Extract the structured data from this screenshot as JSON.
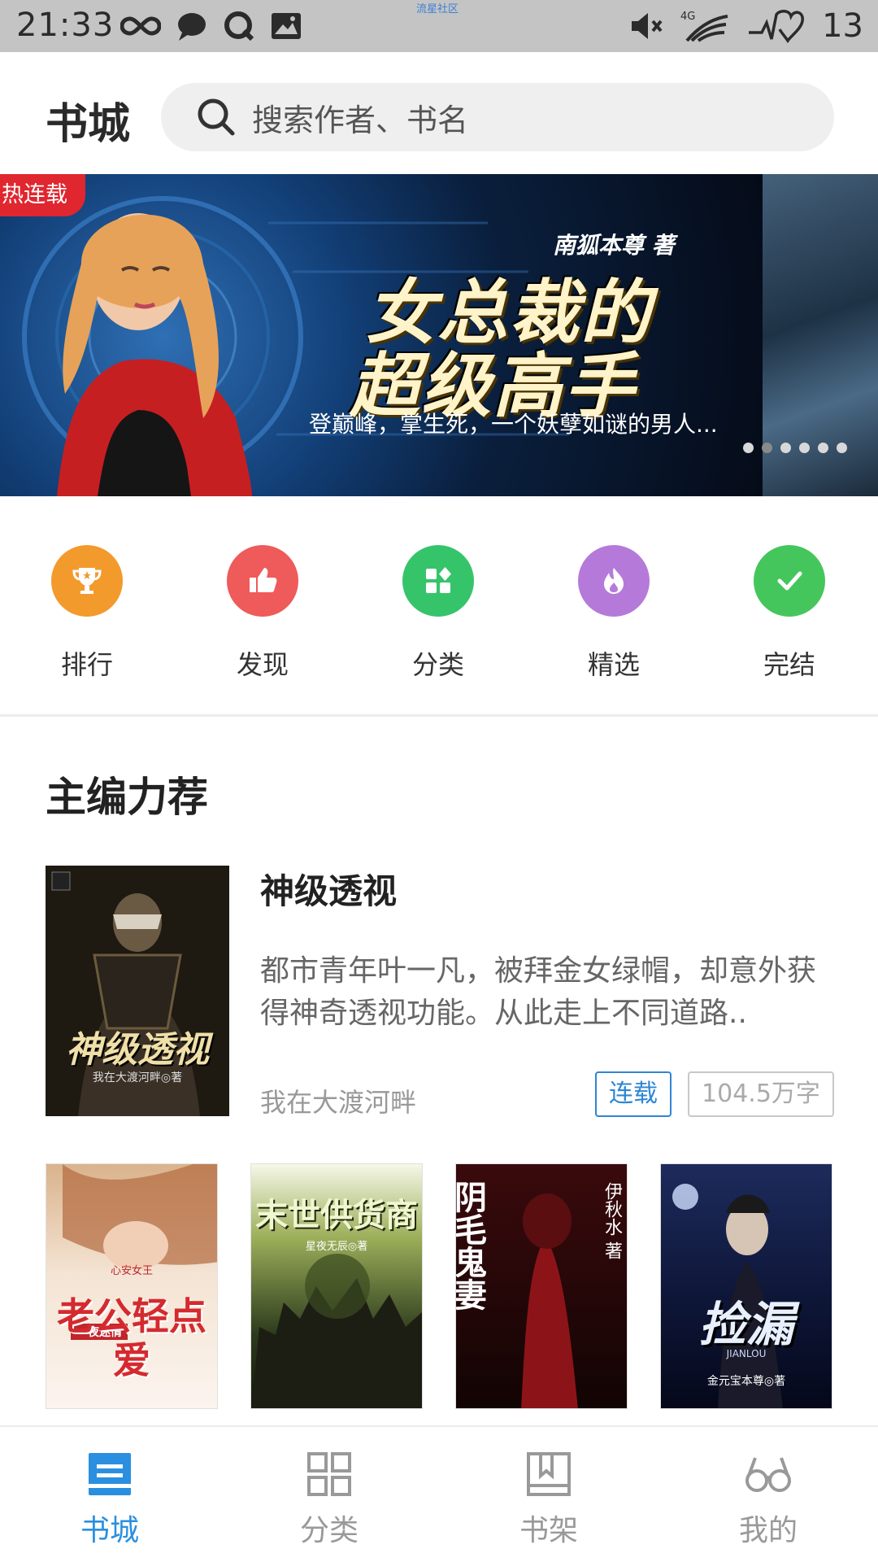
{
  "status_bar": {
    "time": "21:33",
    "watermark": "流星社区",
    "network": "4G",
    "battery": "13"
  },
  "header": {
    "title": "书城",
    "search_placeholder": "搜索作者、书名"
  },
  "banner": {
    "tag": "热连载",
    "author": "南狐本尊 著",
    "title_line1": "女总裁的",
    "title_line2": "超级高手",
    "subtitle": "登巅峰，掌生死，一个妖孽如谜的男人...",
    "page_count": 6,
    "active_index": 1
  },
  "categories": [
    {
      "label": "排行",
      "icon": "trophy-icon",
      "color": "#f39a2c"
    },
    {
      "label": "发现",
      "icon": "thumbs-up-icon",
      "color": "#ef5a5a"
    },
    {
      "label": "分类",
      "icon": "grid-icon",
      "color": "#36c46b"
    },
    {
      "label": "精选",
      "icon": "flame-icon",
      "color": "#b57ad9"
    },
    {
      "label": "完结",
      "icon": "check-icon",
      "color": "#45c65c"
    }
  ],
  "section": {
    "title": "主编力荐"
  },
  "featured": {
    "title": "神级透视",
    "description": "都市青年叶一凡，被拜金女绿帽，却意外获得神奇透视功能。从此走上不同道路..",
    "author": "我在大渡河畔",
    "status_tag": "连载",
    "word_count": "104.5万字",
    "cover_title": "神级透视",
    "cover_author": "我在大渡河畔◎著"
  },
  "covers": [
    {
      "title": "老公轻点爱",
      "subtitle": "一夜迷情",
      "author": "心安女王"
    },
    {
      "title": "末世供货商",
      "subtitle": "",
      "author": "星夜无辰◎著"
    },
    {
      "title": "阴毛鬼妻",
      "subtitle": "",
      "author": "伊秋水 著"
    },
    {
      "title": "捡漏",
      "subtitle": "JIANLOU",
      "author": "金元宝本尊◎著"
    }
  ],
  "bottom_nav": [
    {
      "label": "书城",
      "icon": "bookstore-icon",
      "active": true
    },
    {
      "label": "分类",
      "icon": "category-grid-icon",
      "active": false
    },
    {
      "label": "书架",
      "icon": "bookshelf-icon",
      "active": false
    },
    {
      "label": "我的",
      "icon": "glasses-icon",
      "active": false
    }
  ],
  "colors": {
    "accent": "#2a8fe0",
    "hot_tag": "#e0262f"
  }
}
